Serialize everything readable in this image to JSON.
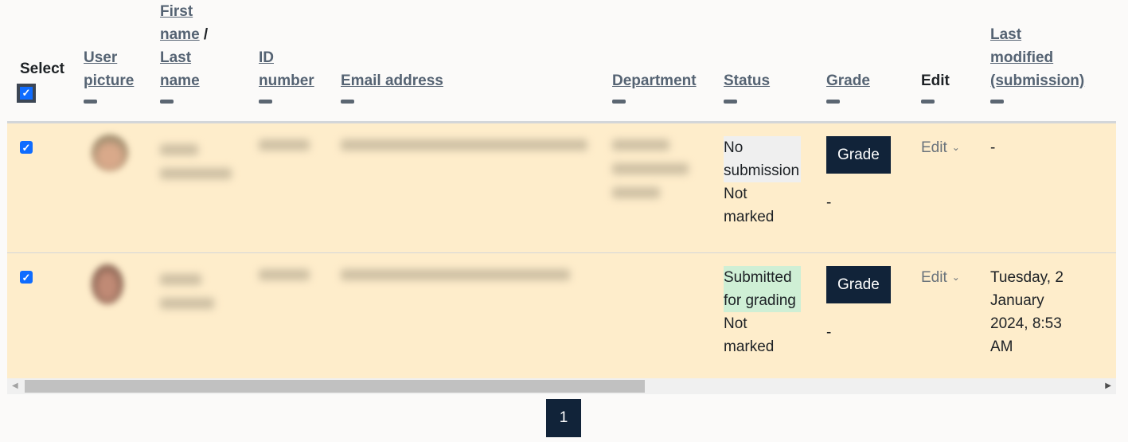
{
  "table": {
    "headers": {
      "select": "Select",
      "user_picture": [
        "User",
        "picture"
      ],
      "name": [
        "First",
        "name",
        "/",
        "Last",
        "name"
      ],
      "id_number": [
        "ID",
        "number"
      ],
      "email": "Email address",
      "department": "Department",
      "status": "Status",
      "grade": "Grade",
      "edit": "Edit",
      "last_modified": [
        "Last",
        "modified",
        "(submission)"
      ]
    },
    "select_all_checked": true,
    "rows": [
      {
        "selected": true,
        "name": "[blurred]",
        "id_number": "[blurred]",
        "email": "[blurred]",
        "department": "[blurred]",
        "status": "No submission",
        "status_color": "#efefef",
        "marking": "Not marked",
        "grade_button": "Grade",
        "grade_value": "-",
        "edit_label": "Edit",
        "last_modified": "-"
      },
      {
        "selected": true,
        "name": "[blurred]",
        "id_number": "[blurred]",
        "email": "[blurred]",
        "department": "",
        "status": "Submitted for grading",
        "status_color": "#cfefd5",
        "marking": "Not marked",
        "grade_button": "Grade",
        "grade_value": "-",
        "edit_label": "Edit",
        "last_modified": "Tuesday, 2 January 2024, 8:53 AM"
      }
    ]
  },
  "pagination": {
    "current_page": "1"
  },
  "colors": {
    "row_bg": "#feedcb",
    "button_bg": "#112339",
    "link": "#556373",
    "checkbox": "#0f6cff"
  }
}
